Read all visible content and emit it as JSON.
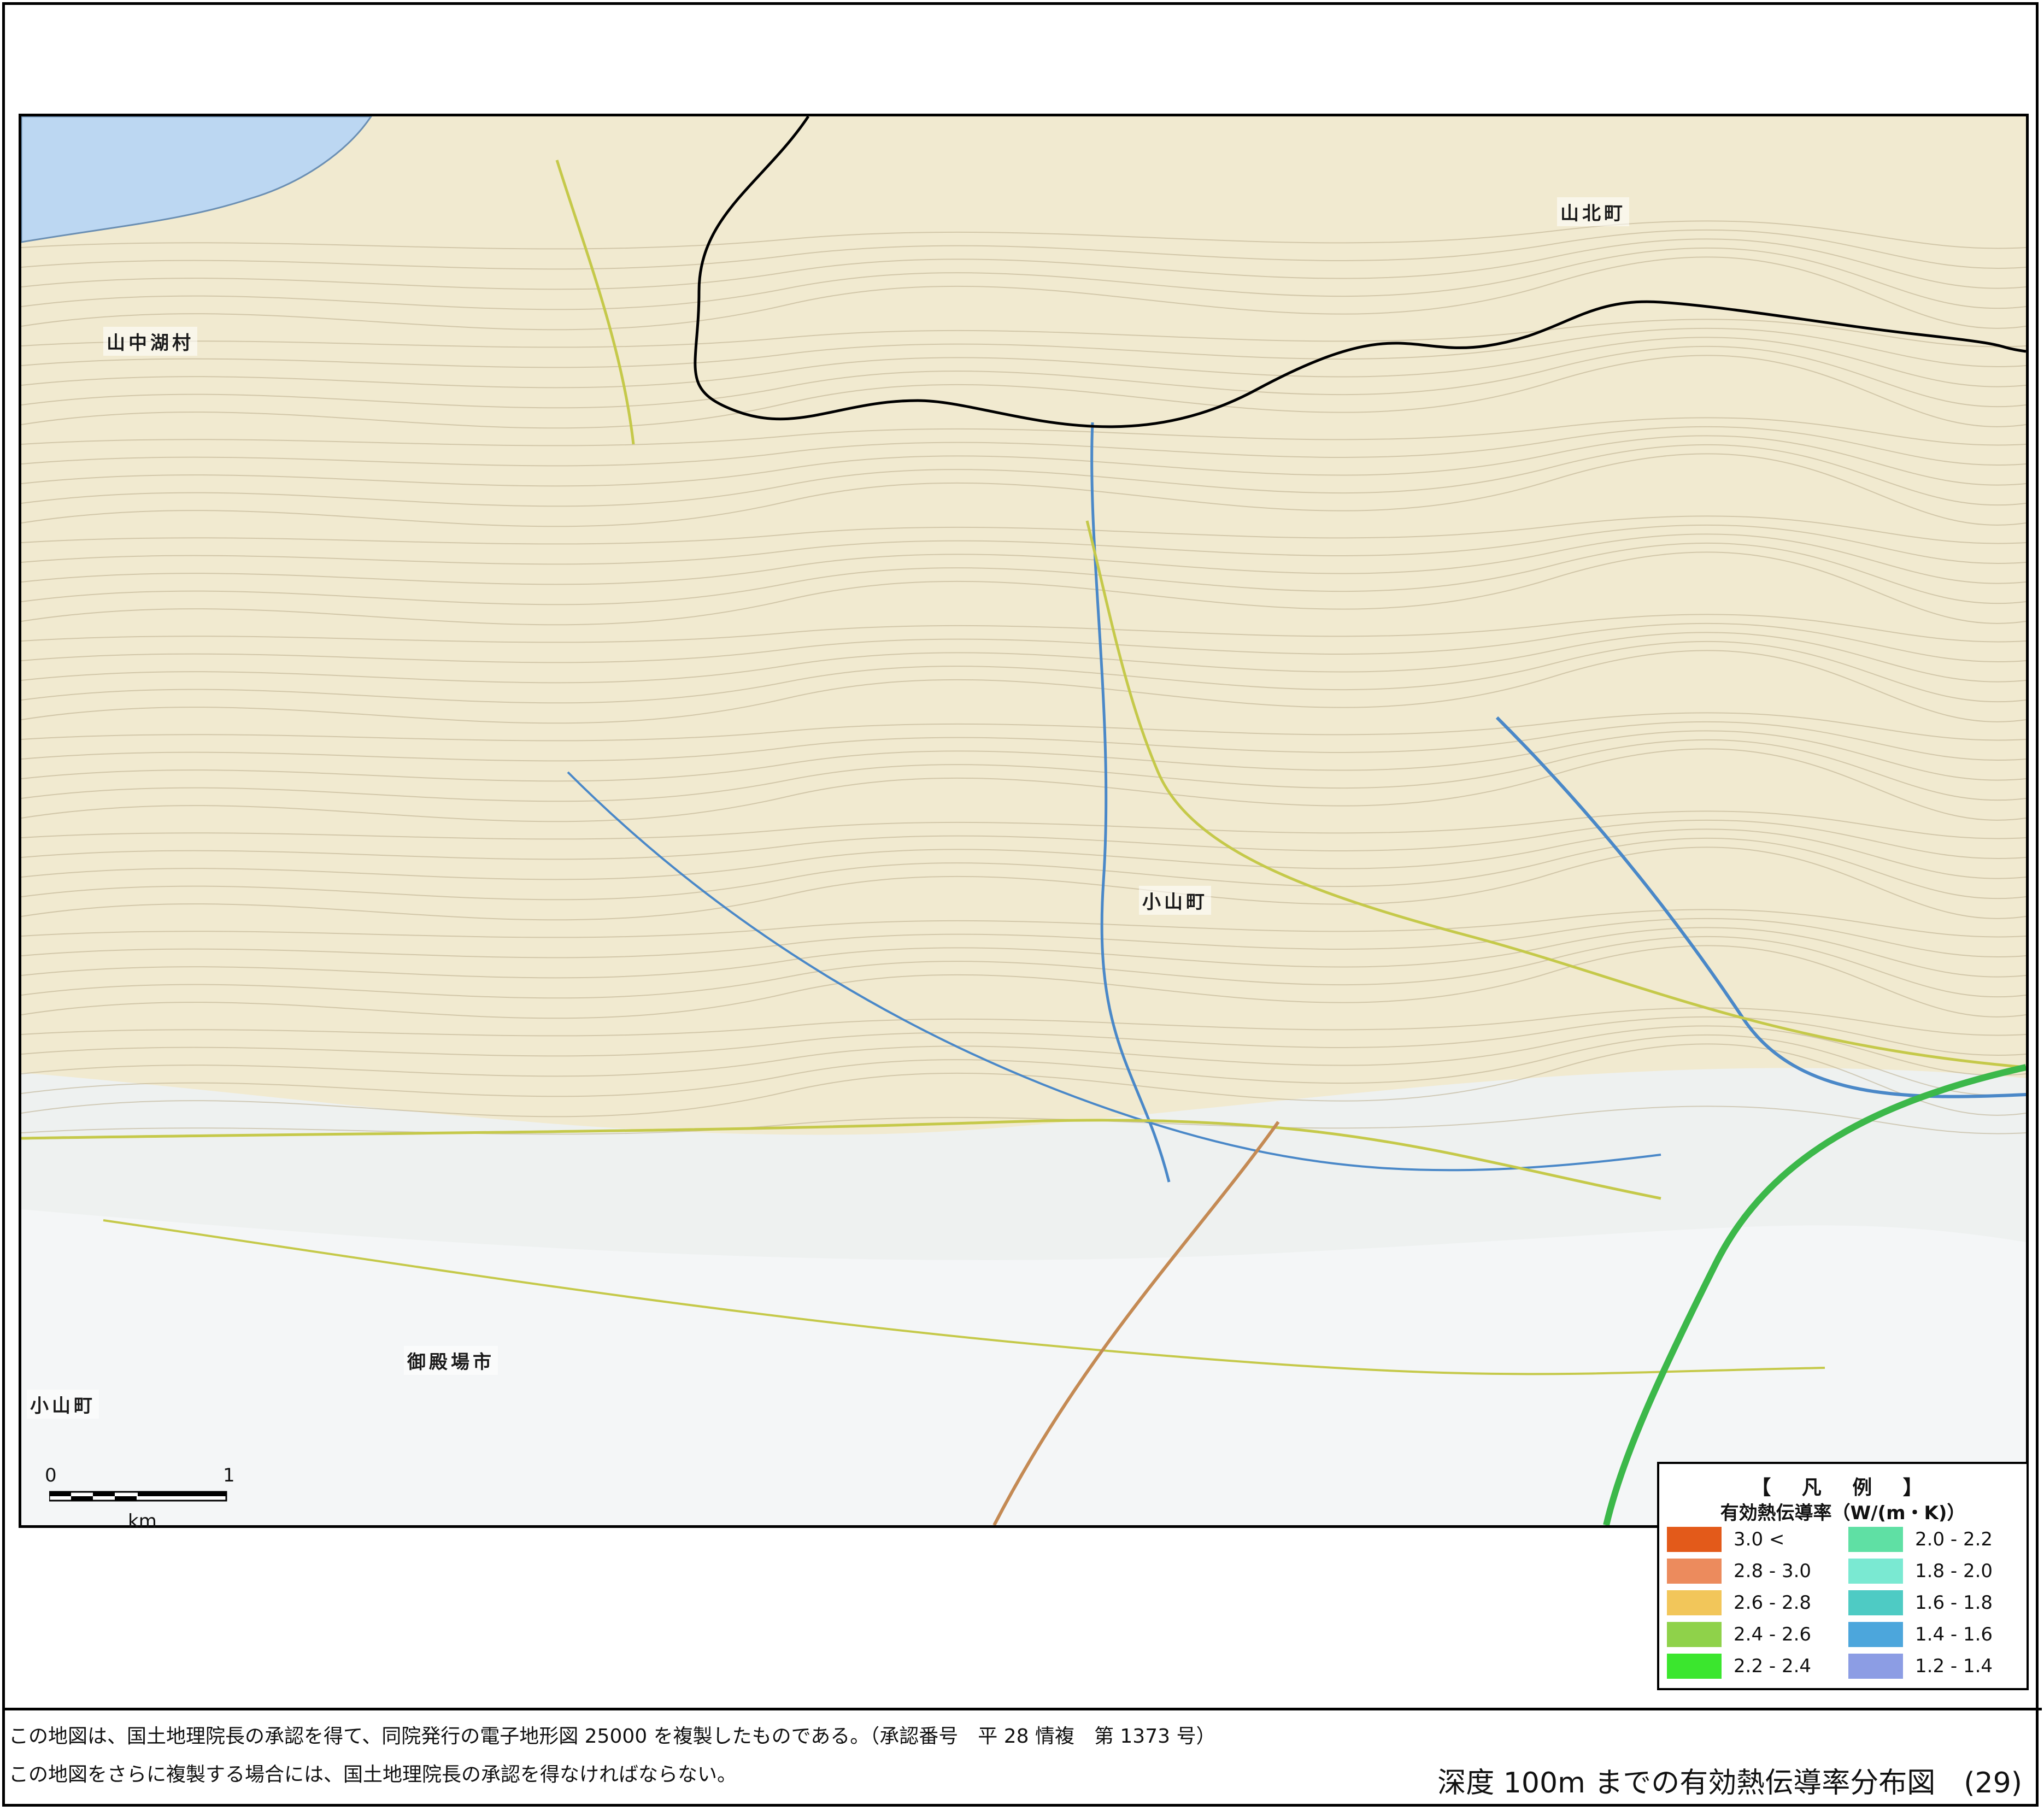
{
  "map": {
    "place_labels": [
      {
        "text": "山中湖村"
      },
      {
        "text": "山北町"
      },
      {
        "text": "小山町"
      },
      {
        "text": "御殿場市"
      },
      {
        "text": "小山町"
      }
    ],
    "colors": {
      "base_map": "#f1ead0",
      "lake": "#bcd7f2",
      "contour": "#b8a988",
      "river": "#4a88c8",
      "road": "#c5c94a",
      "expressway": "#3cb84a",
      "boundary": "#000000"
    }
  },
  "scalebar": {
    "start_label": "0",
    "end_label": "1",
    "unit_label": "km"
  },
  "legend": {
    "title": "【 凡 例 】",
    "subtitle": "有効熱伝導率（W/(m・K)）",
    "items": [
      {
        "label": "3.0 <",
        "color": "#e35a1a"
      },
      {
        "label": "2.8 - 3.0",
        "color": "#ec8b5d"
      },
      {
        "label": "2.6 - 2.8",
        "color": "#f2c65a"
      },
      {
        "label": "2.4 - 2.6",
        "color": "#8fd24a"
      },
      {
        "label": "2.2 - 2.4",
        "color": "#3be62e"
      },
      {
        "label": "2.0 - 2.2",
        "color": "#5fe0a4"
      },
      {
        "label": "1.8 - 2.0",
        "color": "#7ae9d2"
      },
      {
        "label": "1.6 - 1.8",
        "color": "#4ecbc4"
      },
      {
        "label": "1.4 - 1.6",
        "color": "#4ca6dc"
      },
      {
        "label": "1.2 - 1.4",
        "color": "#8c9de4"
      }
    ]
  },
  "footer": {
    "line1": "この地図は、国土地理院長の承認を得て、同院発行の電子地形図 25000 を複製したものである。（承認番号　平 28 情複　第 1373 号）",
    "line2": "この地図をさらに複製する場合には、国土地理院長の承認を得なければならない。",
    "caption": "深度 100m までの有効熱伝導率分布図　(29)"
  }
}
